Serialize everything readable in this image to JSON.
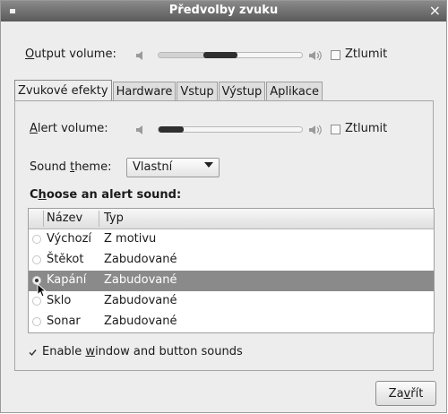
{
  "window": {
    "title": "Předvolby zvuku",
    "close_glyph": "×"
  },
  "output": {
    "label_underlined": "O",
    "label_rest": "utput volume:",
    "level": 0.55,
    "mute_label": "Ztlumit",
    "muted": false
  },
  "tabs": [
    {
      "label": "Zvukové efekty",
      "active": true
    },
    {
      "label": "Hardware",
      "active": false
    },
    {
      "label": "Vstup",
      "active": false
    },
    {
      "label": "Výstup",
      "active": false
    },
    {
      "label": "Aplikace",
      "active": false
    }
  ],
  "alert": {
    "label_underlined": "A",
    "label_rest": "lert volume:",
    "level": 0.17,
    "mute_label": "Ztlumit",
    "muted": false
  },
  "theme": {
    "label_prefix": "Sound ",
    "label_underlined": "t",
    "label_rest": "heme:",
    "value": "Vlastní"
  },
  "choose": {
    "prefix": "C",
    "underlined": "h",
    "rest": "oose an alert sound:"
  },
  "list": {
    "col_name": "Název",
    "col_type": "Typ",
    "rows": [
      {
        "name": "Výchozí",
        "type": "Z motivu",
        "selected": false
      },
      {
        "name": "Štěkot",
        "type": "Zabudované",
        "selected": false
      },
      {
        "name": "Kapání",
        "type": "Zabudované",
        "selected": true
      },
      {
        "name": "Sklo",
        "type": "Zabudované",
        "selected": false
      },
      {
        "name": "Sonar",
        "type": "Zabudované",
        "selected": false
      }
    ]
  },
  "enable_sounds": {
    "checked": true,
    "prefix": "Enable ",
    "underlined": "w",
    "rest": "indow and button sounds"
  },
  "close_button": {
    "prefix": "Za",
    "underlined": "v",
    "rest": "řít"
  },
  "colors": {
    "titlebar": "#6a6a6a",
    "selection": "#8a8a8a",
    "window_bg": "#ededed"
  }
}
